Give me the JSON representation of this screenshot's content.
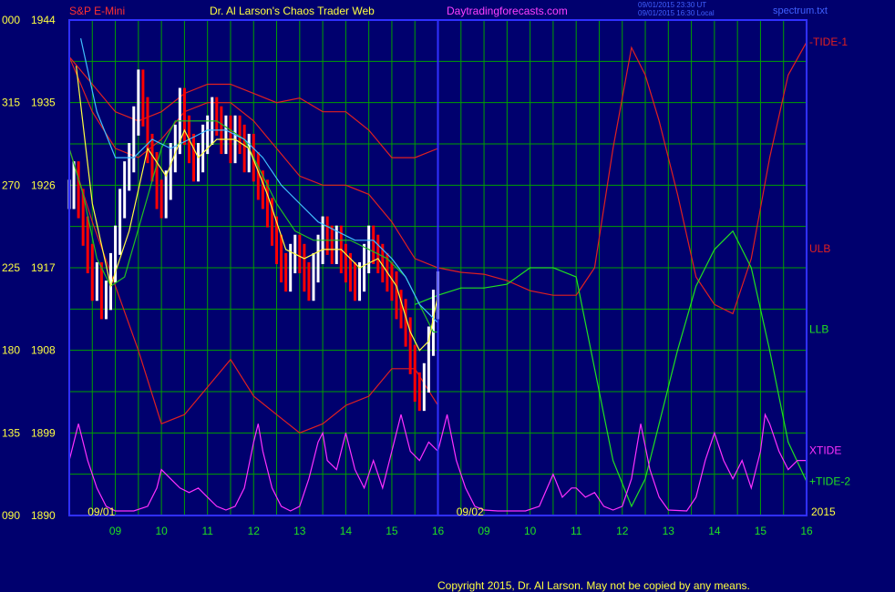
{
  "header": {
    "symbol": "S&P E-Mini",
    "title": "Dr. Al Larson's Chaos Trader Web",
    "site": "Daytradingforecasts.com",
    "stamp_line1": "09/01/2015 23:30 UT",
    "stamp_line2": "09/01/2015 16:30 Local",
    "file": "spectrum.txt"
  },
  "footer": {
    "copyright": "Copyright 2015, Dr. Al Larson. May not be copied by any means."
  },
  "colors": {
    "background": "#00006e",
    "grid": "#00a000",
    "axis": "#3030ff",
    "price_up": "#ffffff",
    "price_down": "#ff0000",
    "ma_yellow": "#ffff40",
    "ma_cyan": "#40c0ff",
    "ma_green": "#20c020",
    "ulb": "#e02020",
    "llb": "#20e020",
    "xtide": "#ff30ff"
  },
  "chart_data": {
    "type": "line",
    "title": "S&P E-Mini",
    "ylim": [
      1890,
      1944
    ],
    "left_ticks": [
      {
        "code": "000",
        "price": "1944",
        "value": 1944
      },
      {
        "code": "315",
        "price": "1935",
        "value": 1935
      },
      {
        "code": "270",
        "price": "1926",
        "value": 1926
      },
      {
        "code": "225",
        "price": "1917",
        "value": 1917
      },
      {
        "code": "180",
        "price": "1908",
        "value": 1908
      },
      {
        "code": "135",
        "price": "1899",
        "value": 1899
      },
      {
        "code": "090",
        "price": "1890",
        "value": 1890
      }
    ],
    "xlim": [
      8,
      24
    ],
    "x_ticks": [
      {
        "label": "09",
        "t": 9
      },
      {
        "label": "10",
        "t": 10
      },
      {
        "label": "11",
        "t": 11
      },
      {
        "label": "12",
        "t": 12
      },
      {
        "label": "13",
        "t": 13
      },
      {
        "label": "14",
        "t": 14
      },
      {
        "label": "15",
        "t": 15
      },
      {
        "label": "16",
        "t": 16
      },
      {
        "label": "09",
        "t": 17
      },
      {
        "label": "10",
        "t": 18
      },
      {
        "label": "11",
        "t": 19
      },
      {
        "label": "12",
        "t": 20
      },
      {
        "label": "13",
        "t": 21
      },
      {
        "label": "14",
        "t": 22
      },
      {
        "label": "15",
        "t": 23
      },
      {
        "label": "16",
        "t": 24
      }
    ],
    "date_labels": [
      {
        "label": "09/01",
        "t": 8.4
      },
      {
        "label": "09/02",
        "t": 16.4
      }
    ],
    "year_label": "2015",
    "divider_t": 16,
    "legend": [
      {
        "label": "-TIDE-1",
        "color": "#e02020",
        "value": 1941.6
      },
      {
        "label": "ULB",
        "color": "#e02020",
        "value": 1919.1
      },
      {
        "label": "LLB",
        "color": "#20e020",
        "value": 1910.3
      },
      {
        "label": "XTIDE",
        "color": "#ff30ff",
        "value": 1897.1
      },
      {
        "label": "+TIDE-2",
        "color": "#20e020",
        "value": 1893.7
      }
    ],
    "price_close": [
      [
        8.0,
        1925
      ],
      [
        8.1,
        1927
      ],
      [
        8.2,
        1924
      ],
      [
        8.3,
        1921
      ],
      [
        8.4,
        1918
      ],
      [
        8.5,
        1915
      ],
      [
        8.6,
        1916
      ],
      [
        8.7,
        1913
      ],
      [
        8.8,
        1914
      ],
      [
        8.9,
        1917
      ],
      [
        9.0,
        1920
      ],
      [
        9.1,
        1924
      ],
      [
        9.2,
        1927
      ],
      [
        9.3,
        1929
      ],
      [
        9.4,
        1933
      ],
      [
        9.5,
        1937
      ],
      [
        9.6,
        1934
      ],
      [
        9.7,
        1930
      ],
      [
        9.8,
        1928
      ],
      [
        9.9,
        1925
      ],
      [
        10.0,
        1924
      ],
      [
        10.1,
        1926
      ],
      [
        10.2,
        1929
      ],
      [
        10.3,
        1931
      ],
      [
        10.4,
        1935
      ],
      [
        10.5,
        1932
      ],
      [
        10.6,
        1930
      ],
      [
        10.7,
        1928
      ],
      [
        10.8,
        1929
      ],
      [
        10.9,
        1931
      ],
      [
        11.0,
        1932
      ],
      [
        11.1,
        1934
      ],
      [
        11.2,
        1933
      ],
      [
        11.3,
        1931
      ],
      [
        11.4,
        1932
      ],
      [
        11.5,
        1930
      ],
      [
        11.6,
        1932
      ],
      [
        11.7,
        1931
      ],
      [
        11.8,
        1929
      ],
      [
        11.9,
        1930
      ],
      [
        12.0,
        1928
      ],
      [
        12.1,
        1926
      ],
      [
        12.2,
        1925
      ],
      [
        12.3,
        1923
      ],
      [
        12.4,
        1921
      ],
      [
        12.5,
        1919
      ],
      [
        12.6,
        1917
      ],
      [
        12.7,
        1916
      ],
      [
        12.8,
        1918
      ],
      [
        12.9,
        1919
      ],
      [
        13.0,
        1918
      ],
      [
        13.1,
        1916
      ],
      [
        13.2,
        1915
      ],
      [
        13.3,
        1917
      ],
      [
        13.4,
        1919
      ],
      [
        13.5,
        1921
      ],
      [
        13.6,
        1920
      ],
      [
        13.7,
        1919
      ],
      [
        13.8,
        1920
      ],
      [
        13.9,
        1918
      ],
      [
        14.0,
        1917
      ],
      [
        14.1,
        1916
      ],
      [
        14.2,
        1915
      ],
      [
        14.3,
        1916
      ],
      [
        14.4,
        1918
      ],
      [
        14.5,
        1920
      ],
      [
        14.6,
        1919
      ],
      [
        14.7,
        1918
      ],
      [
        14.8,
        1917
      ],
      [
        14.9,
        1916
      ],
      [
        15.0,
        1915
      ],
      [
        15.1,
        1913
      ],
      [
        15.2,
        1912
      ],
      [
        15.3,
        1910
      ],
      [
        15.4,
        1907
      ],
      [
        15.5,
        1904
      ],
      [
        15.6,
        1903
      ],
      [
        15.7,
        1905
      ],
      [
        15.8,
        1909
      ],
      [
        15.9,
        1913
      ],
      [
        16.0,
        1915
      ]
    ],
    "ma_yellow": [
      [
        8.15,
        1939
      ],
      [
        8.5,
        1924
      ],
      [
        8.9,
        1915
      ],
      [
        9.3,
        1921
      ],
      [
        9.7,
        1930
      ],
      [
        10.1,
        1927
      ],
      [
        10.5,
        1932
      ],
      [
        10.8,
        1929
      ],
      [
        11.2,
        1931
      ],
      [
        11.6,
        1931
      ],
      [
        11.9,
        1930
      ],
      [
        12.3,
        1925
      ],
      [
        12.7,
        1919
      ],
      [
        13.1,
        1918
      ],
      [
        13.5,
        1919
      ],
      [
        13.9,
        1919
      ],
      [
        14.3,
        1917
      ],
      [
        14.7,
        1918
      ],
      [
        15.1,
        1915
      ],
      [
        15.4,
        1910
      ],
      [
        15.6,
        1908
      ],
      [
        15.8,
        1909
      ],
      [
        16.0,
        1914
      ]
    ],
    "ma_cyan": [
      [
        8.25,
        1942
      ],
      [
        8.6,
        1934
      ],
      [
        9.0,
        1929
      ],
      [
        9.4,
        1929
      ],
      [
        9.8,
        1931
      ],
      [
        10.2,
        1930
      ],
      [
        10.6,
        1931
      ],
      [
        11.0,
        1932
      ],
      [
        11.4,
        1932
      ],
      [
        11.8,
        1931
      ],
      [
        12.2,
        1929
      ],
      [
        12.6,
        1926
      ],
      [
        13.0,
        1924
      ],
      [
        13.4,
        1922
      ],
      [
        13.8,
        1921
      ],
      [
        14.2,
        1920
      ],
      [
        14.6,
        1920
      ],
      [
        15.0,
        1918
      ],
      [
        15.3,
        1916
      ],
      [
        15.6,
        1913
      ],
      [
        16.0,
        1911
      ]
    ],
    "ma_green": [
      [
        8.0,
        1930
      ],
      [
        8.3,
        1925
      ],
      [
        8.6,
        1918
      ],
      [
        8.9,
        1915
      ],
      [
        9.2,
        1916
      ],
      [
        9.6,
        1923
      ],
      [
        10.0,
        1930
      ],
      [
        10.3,
        1933
      ],
      [
        10.6,
        1933
      ],
      [
        10.9,
        1933
      ],
      [
        11.2,
        1933
      ],
      [
        11.5,
        1932
      ],
      [
        11.8,
        1931
      ],
      [
        12.1,
        1928
      ],
      [
        12.5,
        1924
      ],
      [
        12.9,
        1921
      ],
      [
        13.3,
        1920
      ],
      [
        13.7,
        1920
      ],
      [
        14.1,
        1920
      ],
      [
        14.5,
        1919
      ],
      [
        14.9,
        1918
      ],
      [
        15.3,
        1916
      ],
      [
        15.6,
        1913
      ],
      [
        15.9,
        1910
      ],
      [
        16.0,
        1910
      ]
    ],
    "ulb": [
      [
        8.0,
        1940
      ],
      [
        8.5,
        1934
      ],
      [
        9.0,
        1930
      ],
      [
        9.5,
        1929
      ],
      [
        10.0,
        1931
      ],
      [
        10.5,
        1934
      ],
      [
        11.0,
        1935
      ],
      [
        11.5,
        1935
      ],
      [
        12.0,
        1933
      ],
      [
        12.5,
        1930
      ],
      [
        13.0,
        1927
      ],
      [
        13.5,
        1926
      ],
      [
        14.0,
        1926
      ],
      [
        14.5,
        1925
      ],
      [
        15.0,
        1922
      ],
      [
        15.5,
        1918
      ],
      [
        16.0,
        1917
      ],
      [
        16.5,
        1916.5
      ],
      [
        17.0,
        1916.3
      ],
      [
        17.5,
        1915.6
      ],
      [
        18.0,
        1914.5
      ],
      [
        18.5,
        1914.0
      ],
      [
        19.0,
        1914.0
      ],
      [
        19.4,
        1917
      ],
      [
        19.8,
        1930
      ],
      [
        20.2,
        1941
      ],
      [
        20.5,
        1938
      ],
      [
        20.8,
        1933
      ],
      [
        21.2,
        1925
      ],
      [
        21.6,
        1916
      ],
      [
        22.0,
        1913
      ],
      [
        22.4,
        1912
      ],
      [
        22.8,
        1918
      ],
      [
        23.2,
        1929
      ],
      [
        23.6,
        1938
      ],
      [
        24.0,
        1941.6
      ]
    ],
    "llb": [
      [
        15.5,
        1913
      ],
      [
        16.0,
        1914
      ],
      [
        16.5,
        1914.8
      ],
      [
        17.0,
        1914.8
      ],
      [
        17.5,
        1915.2
      ],
      [
        18.0,
        1917
      ],
      [
        18.5,
        1917.0
      ],
      [
        19.0,
        1916
      ],
      [
        19.4,
        1906
      ],
      [
        19.8,
        1896
      ],
      [
        20.2,
        1891
      ],
      [
        20.5,
        1894
      ],
      [
        20.8,
        1900
      ],
      [
        21.2,
        1908
      ],
      [
        21.6,
        1915
      ],
      [
        22.0,
        1919
      ],
      [
        22.4,
        1921
      ],
      [
        22.8,
        1917
      ],
      [
        23.2,
        1908
      ],
      [
        23.6,
        1898
      ],
      [
        24.0,
        1893.7
      ]
    ],
    "upper_band": [
      [
        8.0,
        1940
      ],
      [
        8.5,
        1937
      ],
      [
        9.0,
        1934
      ],
      [
        9.5,
        1933
      ],
      [
        10.0,
        1934
      ],
      [
        10.5,
        1936
      ],
      [
        11.0,
        1937
      ],
      [
        11.5,
        1937
      ],
      [
        12.0,
        1936
      ],
      [
        12.5,
        1935
      ],
      [
        13.0,
        1935.5
      ],
      [
        13.5,
        1934
      ],
      [
        14.0,
        1934
      ],
      [
        14.5,
        1932
      ],
      [
        15.0,
        1929
      ],
      [
        15.5,
        1929
      ],
      [
        16.0,
        1930
      ]
    ],
    "lower_band": [
      [
        8.0,
        1930
      ],
      [
        8.5,
        1922
      ],
      [
        9.0,
        1915
      ],
      [
        9.5,
        1908
      ],
      [
        10.0,
        1900
      ],
      [
        10.5,
        1901
      ],
      [
        11.0,
        1904
      ],
      [
        11.5,
        1907
      ],
      [
        12.0,
        1903
      ],
      [
        12.5,
        1901
      ],
      [
        13.0,
        1899
      ],
      [
        13.5,
        1900
      ],
      [
        14.0,
        1902
      ],
      [
        14.5,
        1903
      ],
      [
        15.0,
        1906
      ],
      [
        15.5,
        1906
      ],
      [
        16.0,
        1902
      ]
    ],
    "xtide": [
      [
        8.0,
        1896
      ],
      [
        8.2,
        1900
      ],
      [
        8.4,
        1896
      ],
      [
        8.6,
        1893
      ],
      [
        8.8,
        1891
      ],
      [
        9.0,
        1890.5
      ],
      [
        9.4,
        1890.5
      ],
      [
        9.7,
        1891
      ],
      [
        9.9,
        1893
      ],
      [
        10.0,
        1895
      ],
      [
        10.2,
        1894
      ],
      [
        10.4,
        1893
      ],
      [
        10.6,
        1892.5
      ],
      [
        10.8,
        1893
      ],
      [
        11.0,
        1892
      ],
      [
        11.2,
        1891
      ],
      [
        11.4,
        1890.6
      ],
      [
        11.6,
        1891
      ],
      [
        11.8,
        1893
      ],
      [
        12.0,
        1898
      ],
      [
        12.1,
        1900
      ],
      [
        12.2,
        1897
      ],
      [
        12.4,
        1893
      ],
      [
        12.6,
        1891
      ],
      [
        12.8,
        1890.5
      ],
      [
        13.0,
        1891
      ],
      [
        13.2,
        1894
      ],
      [
        13.4,
        1898
      ],
      [
        13.5,
        1899
      ],
      [
        13.6,
        1896
      ],
      [
        13.8,
        1895
      ],
      [
        14.0,
        1899
      ],
      [
        14.2,
        1895
      ],
      [
        14.4,
        1893
      ],
      [
        14.6,
        1896
      ],
      [
        14.8,
        1893
      ],
      [
        15.0,
        1897
      ],
      [
        15.2,
        1901
      ],
      [
        15.4,
        1897
      ],
      [
        15.6,
        1896
      ],
      [
        15.8,
        1898
      ],
      [
        16.0,
        1897
      ],
      [
        16.2,
        1901
      ],
      [
        16.4,
        1896
      ],
      [
        16.6,
        1893
      ],
      [
        16.8,
        1891
      ],
      [
        17.0,
        1890.6
      ],
      [
        17.3,
        1890.5
      ],
      [
        17.6,
        1890.5
      ],
      [
        17.9,
        1890.5
      ],
      [
        18.2,
        1891
      ],
      [
        18.5,
        1894.5
      ],
      [
        18.7,
        1892
      ],
      [
        18.9,
        1893
      ],
      [
        19.0,
        1893
      ],
      [
        19.2,
        1892
      ],
      [
        19.4,
        1892.5
      ],
      [
        19.6,
        1891
      ],
      [
        19.8,
        1890.6
      ],
      [
        20.0,
        1891
      ],
      [
        20.2,
        1894
      ],
      [
        20.4,
        1900
      ],
      [
        20.6,
        1895
      ],
      [
        20.8,
        1892
      ],
      [
        21.0,
        1890.6
      ],
      [
        21.4,
        1890.5
      ],
      [
        21.6,
        1892
      ],
      [
        21.8,
        1896
      ],
      [
        22.0,
        1899
      ],
      [
        22.2,
        1896
      ],
      [
        22.4,
        1894
      ],
      [
        22.6,
        1896
      ],
      [
        22.8,
        1893
      ],
      [
        23.0,
        1897
      ],
      [
        23.1,
        1901
      ],
      [
        23.2,
        1900
      ],
      [
        23.4,
        1897
      ],
      [
        23.6,
        1895
      ],
      [
        23.8,
        1896
      ],
      [
        24.0,
        1896
      ]
    ]
  }
}
